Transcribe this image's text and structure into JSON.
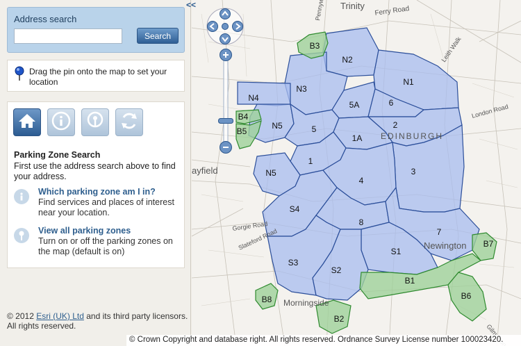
{
  "sidebar": {
    "search": {
      "title": "Address search",
      "input_value": "",
      "input_placeholder": "",
      "button_label": "Search"
    },
    "pin_hint": "Drag the pin onto the map to set your location",
    "tools": [
      {
        "icon": "home-icon",
        "active": true
      },
      {
        "icon": "info-icon",
        "active": false
      },
      {
        "icon": "pin-location-icon",
        "active": false
      },
      {
        "icon": "refresh-icon",
        "active": false
      }
    ],
    "panel_title": "Parking Zone Search",
    "panel_desc": "First use the address search above to find your address.",
    "options": [
      {
        "icon": "info-icon",
        "title": "Which parking zone am I in?",
        "desc": "Find services and places of interest near your location."
      },
      {
        "icon": "pin-location-icon",
        "title": "View all parking zones",
        "desc": "Turn on or off the parking zones on the map (default is on)"
      }
    ],
    "footer": {
      "prefix": "© 2012 ",
      "link": "Esri (UK) Ltd",
      "suffix": " and its third party licensors.",
      "line2": "All rights reserved."
    }
  },
  "map": {
    "collapse_label": "<<",
    "copyright": "© Crown Copyright and database right. All rights reserved. Ordnance Survey License number 100023420.",
    "colors": {
      "zone_fill": "#a8bcef",
      "zone_stroke": "#2c4f9a",
      "green_fill": "#9fd19a",
      "green_stroke": "#2f8a2f"
    },
    "place_labels": [
      "Trinity",
      "Ferry Road",
      "Leith Walk",
      "London Road",
      "ayfield",
      "Gorgie Road",
      "Slateford Road",
      "Newington",
      "Morningside",
      "Gilmerton",
      "Pennywell Road",
      "EDINBURGH"
    ],
    "blue_zones": [
      "N2",
      "N1",
      "N3",
      "N4",
      "5A",
      "6",
      "N5",
      "5",
      "2",
      "1A",
      "1",
      "3",
      "N5",
      "4",
      "S4",
      "8",
      "7",
      "S1",
      "S3",
      "S2"
    ],
    "green_zones": [
      "B3",
      "B4",
      "B5",
      "B7",
      "B1",
      "B6",
      "B8",
      "B2"
    ]
  }
}
